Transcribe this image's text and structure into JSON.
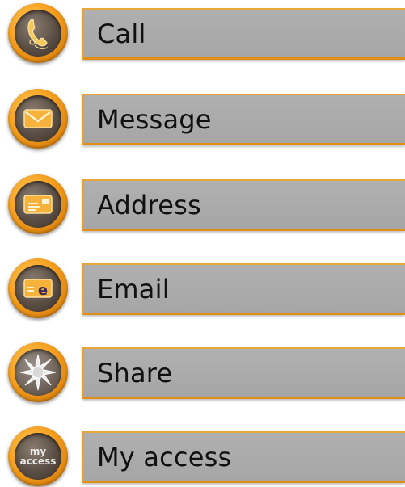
{
  "menu": {
    "items": [
      {
        "label": "Call",
        "icon": "phone-icon"
      },
      {
        "label": "Message",
        "icon": "envelope-icon"
      },
      {
        "label": "Address",
        "icon": "address-card-icon"
      },
      {
        "label": "Email",
        "icon": "email-card-icon"
      },
      {
        "label": "Share",
        "icon": "share-icon"
      },
      {
        "label": "My access",
        "icon": "my-access-icon"
      }
    ],
    "myaccess_badge": {
      "line1": "my",
      "line2": "access"
    }
  },
  "colors": {
    "accent": "#f5a020",
    "label_bg": "#aaaaaa",
    "label_border": "#e08f16",
    "badge_inner": "#5a4e44",
    "text": "#111111"
  }
}
